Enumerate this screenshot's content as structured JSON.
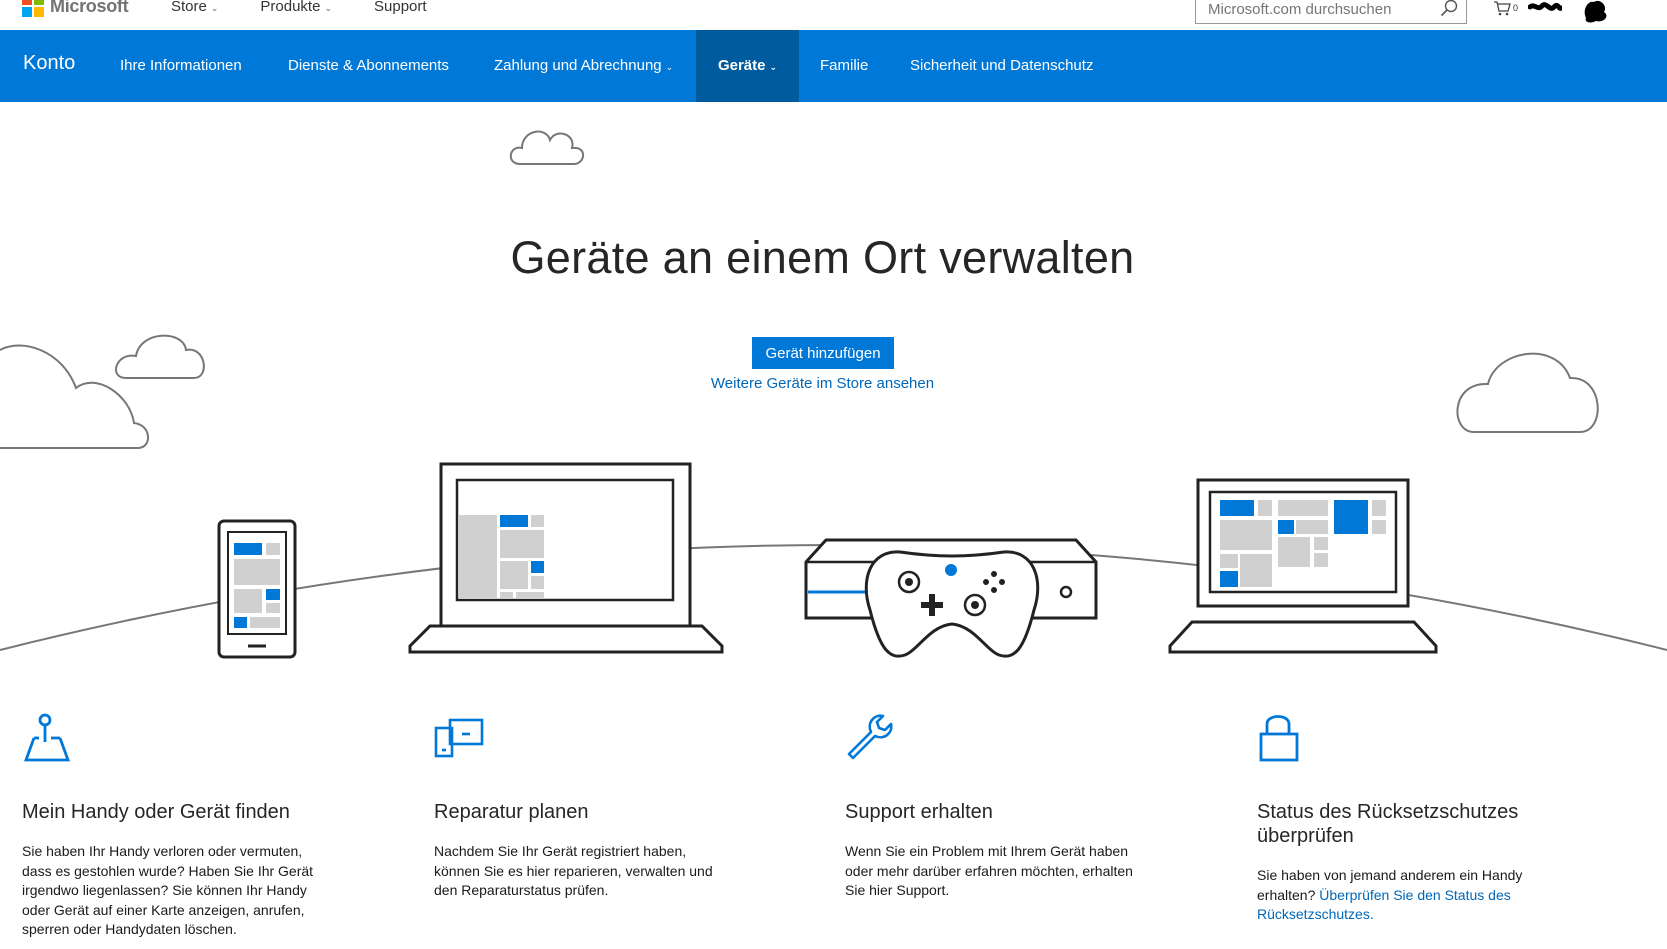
{
  "header": {
    "brand": "Microsoft",
    "nav": [
      {
        "label": "Store"
      },
      {
        "label": "Produkte"
      },
      {
        "label": "Support"
      }
    ],
    "search_placeholder": "Microsoft.com durchsuchen",
    "cart_count": "0"
  },
  "account_nav": {
    "brand": "Konto",
    "items": [
      {
        "label": "Ihre Informationen"
      },
      {
        "label": "Dienste & Abonnements"
      },
      {
        "label": "Zahlung und Abrechnung"
      },
      {
        "label": "Geräte"
      },
      {
        "label": "Familie"
      },
      {
        "label": "Sicherheit und Datenschutz"
      }
    ],
    "active_item": "Geräte"
  },
  "hero": {
    "title": "Geräte an einem Ort verwalten",
    "add_button": "Gerät hinzufügen",
    "store_link": "Weitere Geräte im Store ansehen"
  },
  "features": [
    {
      "icon": "map-pin-icon",
      "title": "Mein Handy oder Gerät finden",
      "text": "Sie haben Ihr Handy verloren oder vermuten, dass es gestohlen wurde? Haben Sie Ihr Gerät irgendwo liegenlassen? Sie können Ihr Handy oder Gerät auf einer Karte anzeigen, anrufen, sperren oder Handydaten löschen."
    },
    {
      "icon": "devices-icon",
      "title": "Reparatur planen",
      "text": "Nachdem Sie Ihr Gerät registriert haben, können Sie es hier reparieren, verwalten und den Reparaturstatus prüfen."
    },
    {
      "icon": "wrench-icon",
      "title": "Support erhalten",
      "text": "Wenn Sie ein Problem mit Ihrem Gerät haben oder mehr darüber erfahren möchten, erhalten Sie hier Support."
    },
    {
      "icon": "lock-icon",
      "title": "Status des Rücksetzschutzes überprüfen",
      "text": "Sie haben von jemand anderem ein Handy erhalten?",
      "link": "Überprüfen Sie den Status des Rücksetzschutzes."
    }
  ],
  "colors": {
    "accent": "#0078d7",
    "accent_active": "#005a9e",
    "link": "#0067b8"
  }
}
